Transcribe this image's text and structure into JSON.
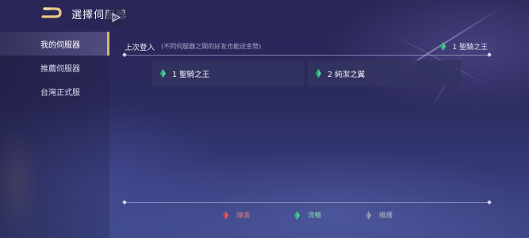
{
  "header": {
    "title": "選擇伺服器",
    "back_icon": "back-arrow-icon",
    "badge_icon": "play-triangle-icon"
  },
  "sidebar": {
    "items": [
      {
        "label": "我的伺服器",
        "active": true
      },
      {
        "label": "推薦伺服器",
        "active": false
      },
      {
        "label": "台灣正式服",
        "active": false
      }
    ]
  },
  "last_login": {
    "label": "上次登入",
    "note": "(不同伺服器之間的好友也能送金幣)",
    "server": "1 聖騎之王",
    "status": "smooth"
  },
  "servers": [
    {
      "name": "1 聖騎之王",
      "status": "smooth"
    },
    {
      "name": "2 純潔之翼",
      "status": "smooth"
    }
  ],
  "legend": [
    {
      "label": "爆滿",
      "color": "#e0646a"
    },
    {
      "label": "流暢",
      "color": "#4fd49a"
    },
    {
      "label": "維護",
      "color": "#9a9ab0"
    }
  ],
  "colors": {
    "full": "#e0646a",
    "smooth": "#4fd49a",
    "maintenance": "#9a9ab0",
    "accent": "#d8b678"
  }
}
